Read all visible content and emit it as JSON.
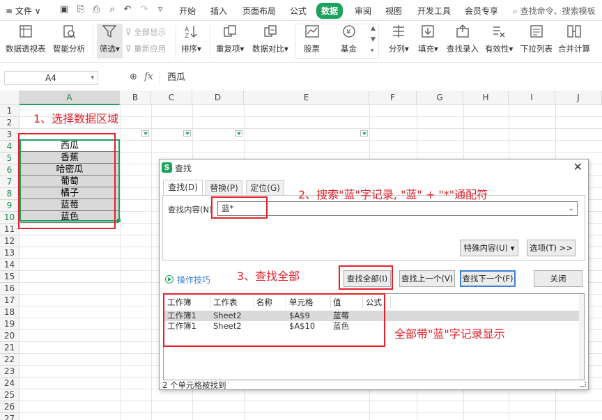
{
  "menubar": {
    "file": "文件",
    "tabs": [
      "开始",
      "插入",
      "页面布局",
      "公式",
      "数据",
      "审阅",
      "视图",
      "开发工具",
      "会员专享"
    ],
    "active_tab": "数据",
    "search_placeholder": "查找命令、搜索模板"
  },
  "ribbon": {
    "pivot": "数据透视表",
    "smart": "智能分析",
    "filter": "筛选",
    "show_all": "全部显示",
    "reapply": "重新应用",
    "sort": "排序",
    "duplicates": "重复项",
    "compare": "数据对比",
    "stock": "股票",
    "fund": "基金",
    "split": "分列",
    "fill": "填充",
    "lookup": "查找录入",
    "validity": "有效性",
    "dropdown": "下拉列表",
    "merge_calc": "合并计算"
  },
  "formula": {
    "cell_ref": "A4",
    "fx": "fx",
    "value": "西瓜"
  },
  "grid": {
    "columns": [
      "A",
      "B",
      "C",
      "D",
      "E",
      "F",
      "G",
      "H",
      "I",
      "J"
    ],
    "rows": [
      "1",
      "2",
      "3",
      "4",
      "5",
      "6",
      "7",
      "8",
      "9",
      "10",
      "11",
      "12",
      "13",
      "14",
      "15",
      "16",
      "17",
      "18",
      "19",
      "20",
      "21",
      "22",
      "23",
      "24",
      "25",
      "26",
      "27",
      "28"
    ],
    "cells": [
      "西瓜",
      "香蕉",
      "哈密瓜",
      "葡萄",
      "橘子",
      "蓝莓",
      "蓝色"
    ]
  },
  "annotations": {
    "step1": "1、选择数据区域",
    "step2": "2、搜索\"蓝\"字记录, \"蓝\" + \"*\"通配符",
    "step3": "3、查找全部",
    "result": "全部带\"蓝\"字记录显示"
  },
  "dialog": {
    "title": "查找",
    "close": "✕",
    "tabs": [
      "查找(D)",
      "替换(P)",
      "定位(G)"
    ],
    "find_label": "查找内容(N)",
    "find_value": "蓝*",
    "special": "特殊内容(U) ▾",
    "options": "选项(T) >>",
    "tips": "操作技巧",
    "find_all": "查找全部(I)",
    "find_prev": "查找上一个(V)",
    "find_next": "查找下一个(F)",
    "close_btn": "关闭",
    "result_headers": [
      "工作簿",
      "工作表",
      "名称",
      "单元格",
      "值",
      "公式"
    ],
    "results": [
      [
        "工作簿1",
        "Sheet2",
        "",
        "$A$9",
        "蓝莓",
        ""
      ],
      [
        "工作簿1",
        "Sheet2",
        "",
        "$A$10",
        "蓝色",
        ""
      ]
    ],
    "status": "2 个单元格被找到"
  }
}
